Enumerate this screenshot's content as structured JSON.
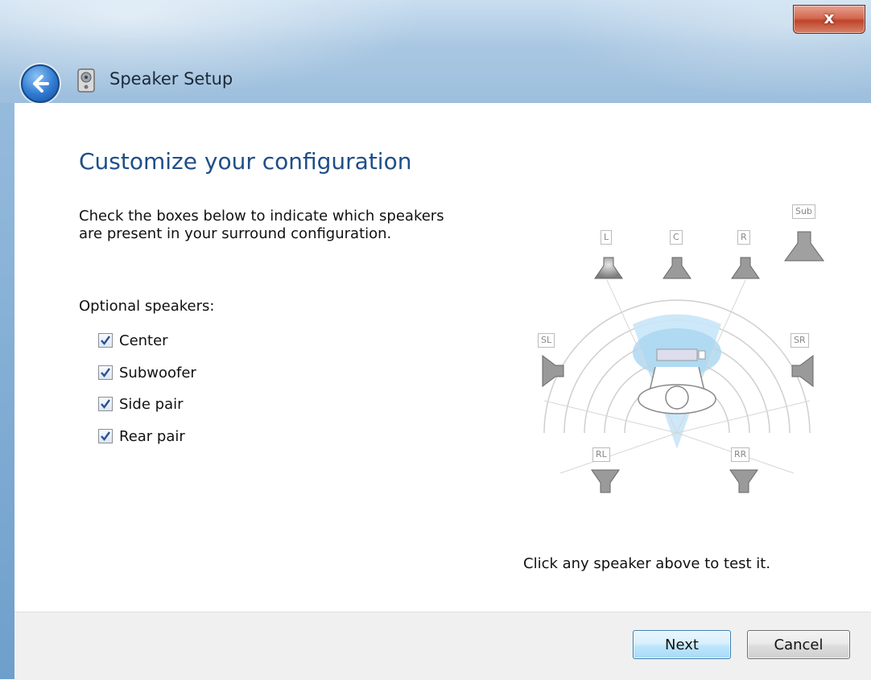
{
  "window": {
    "title": "Speaker Setup",
    "close_label": "x"
  },
  "main": {
    "heading": "Customize your configuration",
    "description": "Check the boxes below to indicate which speakers are present in your surround configuration.",
    "optional_label": "Optional speakers:",
    "options": [
      {
        "label": "Center",
        "checked": true
      },
      {
        "label": "Subwoofer",
        "checked": true
      },
      {
        "label": "Side pair",
        "checked": true
      },
      {
        "label": "Rear pair",
        "checked": true
      }
    ],
    "speakers": {
      "left": "L",
      "center": "C",
      "right": "R",
      "sub": "Sub",
      "side_left": "SL",
      "side_right": "SR",
      "rear_left": "RL",
      "rear_right": "RR"
    },
    "test_hint": "Click any speaker above to test it."
  },
  "footer": {
    "next_label": "Next",
    "cancel_label": "Cancel"
  },
  "colors": {
    "heading": "#1f4e87",
    "accent_blue": "#a8d6f0"
  }
}
